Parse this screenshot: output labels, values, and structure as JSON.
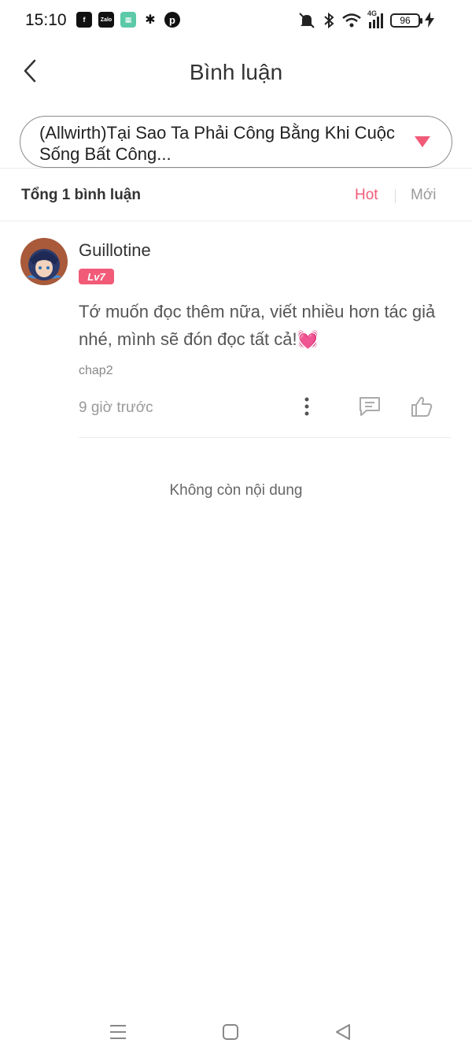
{
  "status_bar": {
    "time": "15:10",
    "battery": "96",
    "network": "4G",
    "left_icons": [
      "facebook-icon",
      "zalo-icon",
      "calculator-icon",
      "bug-icon",
      "pinterest-icon"
    ],
    "right_icons": [
      "mute-icon",
      "bluetooth-icon",
      "wifi-icon",
      "signal-icon",
      "battery-icon",
      "charging-icon"
    ]
  },
  "header": {
    "title": "Bình luận",
    "back_icon": "chevron-left-icon"
  },
  "chapter_selector": {
    "value": "(Allwirth)Tại Sao Ta Phải Công Bằng Khi Cuộc Sống Bất Công...",
    "icon": "triangle-down-icon"
  },
  "comments_bar": {
    "count_label": "Tổng 1 bình luận",
    "sort_hot": "Hot",
    "sort_new": "Mới"
  },
  "comments": [
    {
      "username": "Guillotine",
      "level": "Lv7",
      "text": "Tớ muốn đọc thêm nữa, viết nhiều hơn tác giả nhé, mình sẽ đón đọc tất cả!💓",
      "chapter": "chap2",
      "time": "9 giờ trước"
    }
  ],
  "end_message": "Không còn nội dung",
  "colors": {
    "accent": "#f25b78",
    "text_primary": "#333333",
    "text_secondary": "#999999"
  }
}
